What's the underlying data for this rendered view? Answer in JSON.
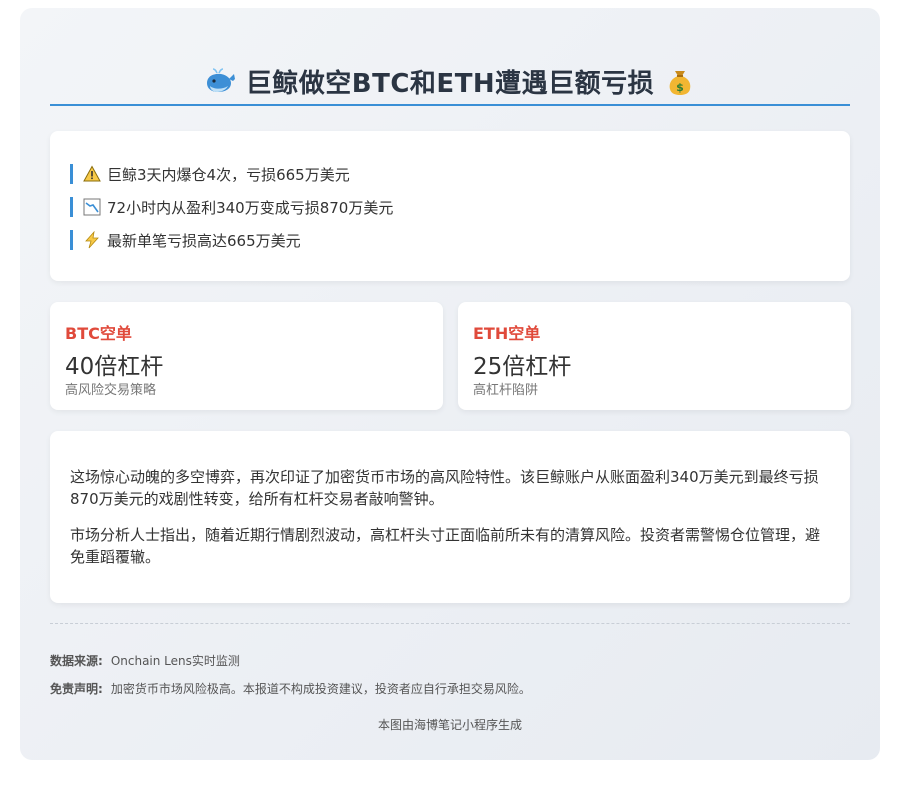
{
  "header": {
    "title": "巨鲸做空BTC和ETH遭遇巨额亏损",
    "left_icon": "whale-icon",
    "right_icon": "money-bag-icon"
  },
  "alerts": [
    {
      "icon": "warning-icon",
      "text": "巨鲸3天内爆仓4次，亏损665万美元"
    },
    {
      "icon": "chart-down-icon",
      "text": "72小时内从盈利340万变成亏损870万美元"
    },
    {
      "icon": "lightning-icon",
      "text": "最新单笔亏损高达665万美元"
    }
  ],
  "stats": [
    {
      "label": "BTC空单",
      "value": "40倍杠杆",
      "sub": "高风险交易策略"
    },
    {
      "label": "ETH空单",
      "value": "25倍杠杆",
      "sub": "高杠杆陷阱"
    }
  ],
  "article": {
    "p1": "这场惊心动魄的多空博弈，再次印证了加密货币市场的高风险特性。该巨鲸账户从账面盈利340万美元到最终亏损870万美元的戏剧性转变，给所有杠杆交易者敲响警钟。",
    "p2": "市场分析人士指出，随着近期行情剧烈波动，高杠杆头寸正面临前所未有的清算风险。投资者需警惕仓位管理，避免重蹈覆辙。"
  },
  "footer": {
    "source_label": "数据来源:",
    "source_text": "Onchain Lens实时监测",
    "disclaimer_label": "免责声明:",
    "disclaimer_text": "加密货币市场风险极高。本报道不构成投资建议，投资者应自行承担交易风险。",
    "credit": "本图由海博笔记小程序生成"
  },
  "colors": {
    "accent": "#3a8fd6",
    "label_red": "#e04a3b",
    "title": "#2b3543"
  }
}
